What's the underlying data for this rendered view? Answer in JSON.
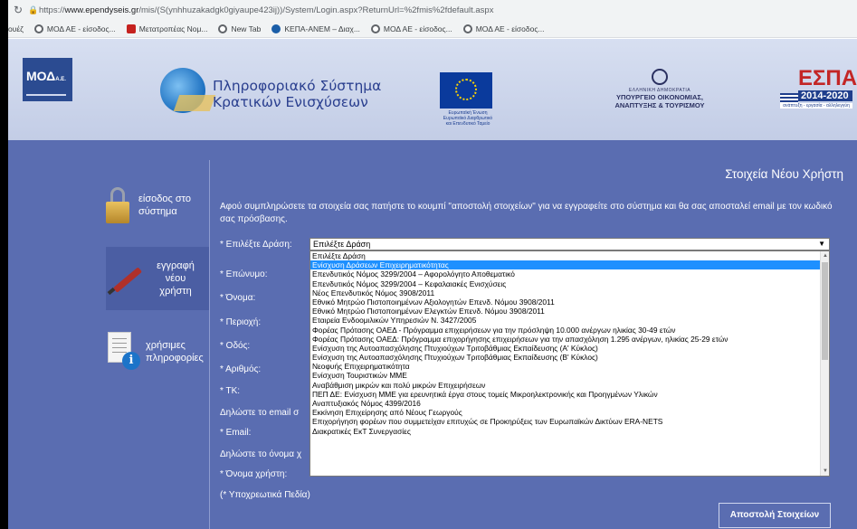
{
  "browser": {
    "url_prefix": "https://",
    "url_host": "www.ependyseis.gr",
    "url_path": "/mis/(S(ynhhuzakadgk0giyaupe423ij))/System/Login.aspx?ReturnUrl=%2fmis%2fdefault.aspx",
    "bookmarks": [
      {
        "label": "ουέζ",
        "icon": "none"
      },
      {
        "label": "ΜΟΔ ΑΕ - είσοδος...",
        "icon": "globe-icon"
      },
      {
        "label": "Μετατροπέας Νομ...",
        "icon": "red-square-icon"
      },
      {
        "label": "New Tab",
        "icon": "globe-icon"
      },
      {
        "label": "ΚΕΠΑ-ΑΝΕΜ – Διαχ...",
        "icon": "blue-dot-icon"
      },
      {
        "label": "ΜΟΔ ΑΕ - είσοδος...",
        "icon": "globe-icon"
      },
      {
        "label": "ΜΟΔ ΑΕ - είσοδος...",
        "icon": "globe-icon"
      }
    ]
  },
  "banner": {
    "moa_text": "ΜΟΔ",
    "moa_suffix": "Α.Ε.",
    "system_title_line1": "Πληροφοριακό Σύστημα",
    "system_title_line2": "Κρατικών Ενισχύσεων",
    "eu_caption": "Ευρωπαϊκή Ένωση Ευρωπαϊκό Διαρθρωτικό και Επενδυτικό Ταμείο",
    "ministry_line1": "ΕΛΛΗΝΙΚΗ ΔΗΜΟΚΡΑΤΙΑ",
    "ministry_line2": "ΥΠΟΥΡΓΕΙΟ ΟΙΚΟΝΟΜΙΑΣ,",
    "ministry_line3": "ΑΝΑΠΤΥΞΗΣ & ΤΟΥΡΙΣΜΟΥ",
    "espa_word": "ΕΣΠΑ",
    "espa_years": "2014-2020",
    "espa_slogan": "ανάπτυξη - εργασία - αλληλεγγύη"
  },
  "sidebar": {
    "login_label": "είσοδος στο σύστημα",
    "register_label": "εγγραφή νέου χρήστη",
    "info_label": "χρήσιμες πληροφορίες"
  },
  "form": {
    "title": "Στοιχεία Νέου Χρήστη",
    "intro": "Αφού συμπληρώσετε τα στοιχεία σας πατήστε το κουμπί \"αποστολή στοιχείων\" για να εγγραφείτε στο σύστημα και θα σας αποσταλεί email με τον κωδικό σας πρόσβασης.",
    "action_label": "* Επιλέξτε Δράση:",
    "action_selected": "Επιλέξτε Δράση",
    "surname_label": "* Επώνυμο:",
    "name_label": "* Όνομα:",
    "region_label": "* Περιοχή:",
    "street_label": "* Οδός:",
    "number_label": "* Αριθμός:",
    "zip_label": "* ΤΚ:",
    "email_section": "Δηλώστε το email σ",
    "email_label": "* Email:",
    "username_section": "Δηλώστε το όνομα χ",
    "username_label": "* Όνομα χρήστη:",
    "required_note": "(* Υποχρεωτικά Πεδία)",
    "submit_label": "Αποστολή Στοιχείων",
    "options": [
      "Επιλέξτε Δράση",
      "Ενίσχυση Δράσεων Επιχειρηματικότητας",
      "Επενδυτικός Νόμος 3299/2004 – Αφορολόγητο Αποθεματικό",
      "Επενδυτικός Νόμος 3299/2004 – Κεφαλαιακές Ενισχύσεις",
      "Νέος Επενδυτικός Νόμος 3908/2011",
      "Εθνικό Μητρώο Πιστοποιημένων Αξιολογητών Επενδ. Νόμου 3908/2011",
      "Εθνικό Μητρώο Πιστοποιημένων Ελεγκτών Επενδ. Νόμου 3908/2011",
      "Εταιρεία Ενδοομιλικών Υπηρεσιών Ν. 3427/2005",
      "Φορέας Πρότασης ΟΑΕΔ - Πρόγραμμα επιχειρήσεων για την πρόσληψη 10.000 ανέργων ηλικίας 30-49 ετών",
      "Φορέας Πρότασης ΟΑΕΔ: Πρόγραμμα επιχορήγησης επιχειρήσεων για την απασχόληση 1.295 ανέργων, ηλικίας 25-29 ετών",
      "Ενίσχυση της Αυτοαπασχόλησης Πτυχιούχων Τριτοβάθμιας Εκπαίδευσης (Α' Κύκλος)",
      "Ενίσχυση της Αυτοαπασχόλησης Πτυχιούχων Τριτοβάθμιας Εκπαίδευσης (Β' Κύκλος)",
      "Νεοφυής Επιχειρηματικότητα",
      "Ενίσχυση Τουριστικών ΜΜΕ",
      "Αναβάθμιση μικρών και πολύ μικρών Επιχειρήσεων",
      "ΠΕΠ ΔΕ: Ενίσχυση ΜΜΕ για ερευνητικά έργα στους τομείς Μικροηλεκτρονικής και Προηγμένων Υλικών",
      "Αναπτυξιακός Νόμος 4399/2016",
      "Εκκίνηση Επιχείρησης από Νέους Γεωργούς",
      "Επιχορήγηση φορέων που συμμετείχαν επιτυχώς σε Προκηρύξεις των Ευρωπαϊκών Δικτύων ERA-NETS",
      "Διακρατικές ΕκΤ Συνεργασίες"
    ],
    "highlighted_index": 1
  },
  "colors": {
    "main_bg": "#5a6db1",
    "highlight": "#1e90ff",
    "banner_bg": "#d7dff1"
  }
}
